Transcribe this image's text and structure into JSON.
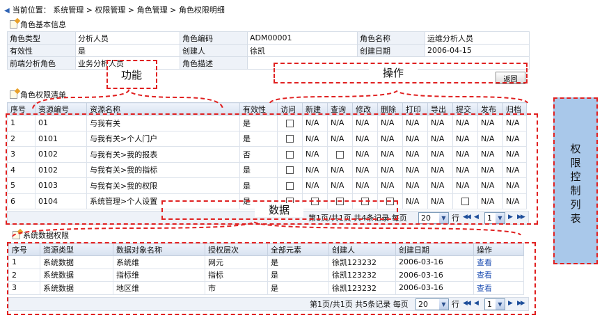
{
  "breadcrumb": {
    "text": "当前位置： 系统管理 > 权限管理 > 角色管理 > 角色权限明细"
  },
  "basic_info": {
    "title": "角色基本信息",
    "rows": [
      [
        {
          "label": "角色类型",
          "value": "分析人员"
        },
        {
          "label": "角色编码",
          "value": "ADM00001"
        },
        {
          "label": "角色名称",
          "value": "运维分析人员"
        }
      ],
      [
        {
          "label": "有效性",
          "value": "是"
        },
        {
          "label": "创建人",
          "value": "徐凯"
        },
        {
          "label": "创建日期",
          "value": "2006-04-15"
        }
      ],
      [
        {
          "label": "前端分析角色",
          "value": "业务分析人员"
        },
        {
          "label": "角色描述",
          "value": ""
        }
      ]
    ]
  },
  "return_button": "返回",
  "role_perm": {
    "title": "角色权限清单",
    "columns": [
      "序号",
      "资源编号",
      "资源名称",
      "有效性",
      "访问",
      "新建",
      "查询",
      "修改",
      "删除",
      "打印",
      "导出",
      "提交",
      "发布",
      "归档"
    ],
    "rows": [
      {
        "no": "1",
        "code": "01",
        "name": "与我有关",
        "valid": "是",
        "perms": [
          "cb",
          "N/A",
          "N/A",
          "N/A",
          "N/A",
          "N/A",
          "N/A",
          "N/A",
          "N/A",
          "N/A"
        ]
      },
      {
        "no": "2",
        "code": "0101",
        "name": "与我有关>个人门户",
        "valid": "是",
        "perms": [
          "cb",
          "N/A",
          "N/A",
          "N/A",
          "N/A",
          "N/A",
          "N/A",
          "N/A",
          "N/A",
          "N/A"
        ]
      },
      {
        "no": "3",
        "code": "0102",
        "name": "与我有关>我的报表",
        "valid": "否",
        "perms": [
          "cb",
          "N/A",
          "cb",
          "N/A",
          "N/A",
          "N/A",
          "N/A",
          "N/A",
          "N/A",
          "N/A"
        ]
      },
      {
        "no": "4",
        "code": "0102",
        "name": "与我有关>我的指标",
        "valid": "是",
        "perms": [
          "cb",
          "N/A",
          "N/A",
          "N/A",
          "N/A",
          "N/A",
          "N/A",
          "N/A",
          "N/A",
          "N/A"
        ]
      },
      {
        "no": "5",
        "code": "0103",
        "name": "与我有关>我的权限",
        "valid": "是",
        "perms": [
          "cb",
          "N/A",
          "N/A",
          "N/A",
          "N/A",
          "N/A",
          "N/A",
          "N/A",
          "N/A",
          "N/A"
        ]
      },
      {
        "no": "6",
        "code": "0104",
        "name": "系统管理>个人设置",
        "valid": "是",
        "perms": [
          "cb",
          "cb",
          "cb",
          "cb",
          "cb",
          "N/A",
          "N/A",
          "cb",
          "N/A",
          "N/A"
        ]
      }
    ],
    "pager": {
      "text": "第1页/共1页  共4条记录  每页",
      "page_size": "20",
      "row_label": "行",
      "page": "1"
    }
  },
  "data_perm": {
    "title": "系统数据权限",
    "columns": [
      "序号",
      "资源类型",
      "数据对象名称",
      "授权层次",
      "全部元素",
      "创建人",
      "创建日期",
      "操作"
    ],
    "rows": [
      {
        "no": "1",
        "type": "系统数据",
        "object": "系统维",
        "level": "网元",
        "all": "是",
        "creator": "徐凯123232",
        "date": "2006-03-16",
        "action": "查看"
      },
      {
        "no": "2",
        "type": "系统数据",
        "object": "指标维",
        "level": "指标",
        "all": "是",
        "creator": "徐凯123232",
        "date": "2006-03-16",
        "action": "查看"
      },
      {
        "no": "3",
        "type": "系统数据",
        "object": "地区维",
        "level": "市",
        "all": "是",
        "creator": "徐凯123232",
        "date": "2006-03-16",
        "action": "查看"
      }
    ],
    "pager": {
      "text": "第1页/共1页  共5条记录  每页",
      "page_size": "20",
      "row_label": "行",
      "page": "1"
    }
  },
  "annotations": {
    "function": "功能",
    "operation": "操作",
    "data": "数据",
    "side_panel": "权\n限\n控\n制\n列\n表"
  },
  "icons": {
    "breadcrumb": "arrow-icon",
    "section": "document-icon",
    "pager_first": "first-page-icon",
    "pager_prev": "prev-page-icon",
    "pager_next": "next-page-icon",
    "pager_last": "last-page-icon"
  },
  "colors": {
    "annotation_red": "#e02020",
    "side_panel_blue": "#a9c8ea",
    "link_blue": "#1f4fb3",
    "header_bg": "#d8e2f0"
  }
}
